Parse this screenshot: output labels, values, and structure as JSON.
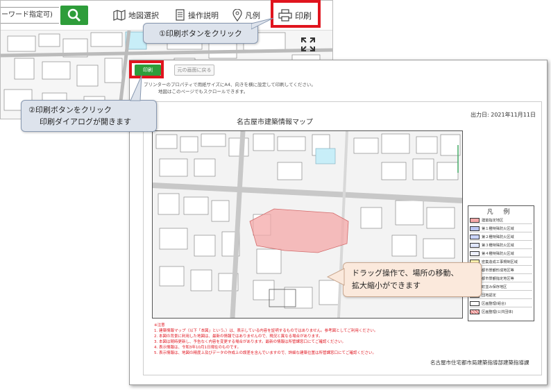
{
  "header": {
    "search_placeholder": "ーワード指定可)",
    "menu": {
      "map_select": "地図選択",
      "manual": "操作説明",
      "legend": "凡例",
      "print": "印刷"
    }
  },
  "preview": {
    "print_button": "印刷",
    "back_button": "元の画面に戻る",
    "notes": [
      "プリンターのプロパティで用紙サイズにA4、向きを横に設定して印刷してください。",
      "地図はこのページでもスクロールできます。"
    ],
    "sheet_title": "名古屋市建築情報マップ",
    "output_date": "出力日: 2021年11月11日",
    "legend_title": "凡 例",
    "legend_items": [
      {
        "label": "建築指定地区",
        "color": "#f4a8a8"
      },
      {
        "label": "第１種特殊防火区域",
        "color": "#b8c4f2"
      },
      {
        "label": "第２種特殊防火区域",
        "color": "#c9d4ff"
      },
      {
        "label": "第３種特殊防火区域",
        "color": "#dfe6ff"
      },
      {
        "label": "第４種特殊防火区域",
        "color": "#eef1ff"
      },
      {
        "label": "密集造成工事規制区域",
        "color": "#fff4b0"
      },
      {
        "label": "都市景観形成地区等",
        "color": "#ffffff"
      },
      {
        "label": "都市景観指定地区等",
        "color": "#ffffff"
      },
      {
        "label": "町並み保存地区",
        "color": "#ffffff"
      },
      {
        "label": "団地認定",
        "color": "#ffffff"
      },
      {
        "label": "区画整理(組合)",
        "color": "#ffffff"
      },
      {
        "label": "区画整理(公共団体)",
        "color": "#f7c9c9"
      }
    ],
    "disclaimer_heading": "※注意",
    "disclaimer": [
      "1. 建築情報マップ（以下「本図」という。）は、表示している内容を証明するものではありません。参考図としてご利用ください。",
      "2. 本図の背景に利用した地図は、最新の情報ではありませんので、現況と異なる場合があります。",
      "3. 本図は随時更新し、予告なく内容を変更する場合があります。最新の情報は所管課窓口にてご確認ください。",
      "4. 表示情報は、令和3年10月1日現在のものです。",
      "5. 表示情報は、地図の精度上及びデータの作成上の誤差を含んでいますので、詳細な建築位置は所管課窓口にてご確認ください。"
    ],
    "footer_org": "名古屋市住宅都市局建築指導部建築指導課"
  },
  "callouts": {
    "step1": "①印刷ボタンをクリック",
    "step2_line1": "②印刷ボタンをクリック",
    "step2_line2": "印刷ダイアログが開きます",
    "drag_line1": "ドラッグ操作で、場所の移動、",
    "drag_line2": "拡大縮小ができます"
  },
  "colors": {
    "accent_green": "#2e9d3a",
    "highlight_red": "#e0141e",
    "callout_blue": "#dde3ec",
    "callout_peach": "#fbe9dc"
  }
}
